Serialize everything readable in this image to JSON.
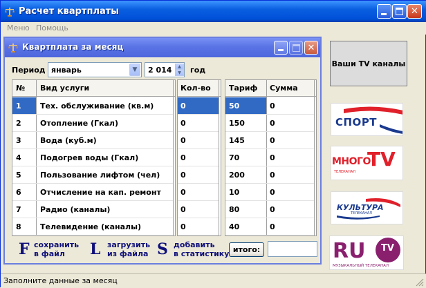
{
  "main_window": {
    "title": "Расчет квартплаты",
    "menu": [
      "Меню",
      "Помощь"
    ]
  },
  "child_window": {
    "title": "Квартплата за месяц",
    "period_label": "Период",
    "month_value": "январь",
    "year_value": "2 014",
    "year_label": "год"
  },
  "grid_services": {
    "headers": [
      "№",
      "Вид услуги"
    ],
    "rows": [
      {
        "num": "1",
        "name": "Тех. обслуживание (кв.м)"
      },
      {
        "num": "2",
        "name": "Отопление (Гкал)"
      },
      {
        "num": "3",
        "name": "Вода (куб.м)"
      },
      {
        "num": "4",
        "name": "Подогрев воды (Гкал)"
      },
      {
        "num": "5",
        "name": "Пользование лифтом (чел)"
      },
      {
        "num": "6",
        "name": "Отчисление на кап. ремонт"
      },
      {
        "num": "7",
        "name": "Радио (каналы)"
      },
      {
        "num": "8",
        "name": "Телевидение (каналы)"
      }
    ]
  },
  "grid_quantity": {
    "header": "Кол-во",
    "values": [
      "0",
      "0",
      "0",
      "0",
      "0",
      "0",
      "0",
      "0"
    ]
  },
  "grid_tariff": {
    "headers": [
      "Тариф",
      "Сумма"
    ],
    "rows": [
      {
        "tariff": "50",
        "sum": "0"
      },
      {
        "tariff": "150",
        "sum": "0"
      },
      {
        "tariff": "145",
        "sum": "0"
      },
      {
        "tariff": "70",
        "sum": "0"
      },
      {
        "tariff": "200",
        "sum": "0"
      },
      {
        "tariff": "10",
        "sum": "0"
      },
      {
        "tariff": "80",
        "sum": "0"
      },
      {
        "tariff": "40",
        "sum": "0"
      }
    ]
  },
  "hotkeys": [
    {
      "letter": "F",
      "line1": "сохранить",
      "line2": "в файл"
    },
    {
      "letter": "L",
      "line1": "загрузить",
      "line2": "из файла"
    },
    {
      "letter": "S",
      "line1": "добавить",
      "line2": "в статистику"
    }
  ],
  "total": {
    "button_label": "итого:",
    "value": ""
  },
  "tv_button_label": "Ваши TV  каналы",
  "channels": [
    {
      "name": "СПОРТ",
      "icon": "sport-logo",
      "color": "#1a3a8f"
    },
    {
      "name": "МНОГО",
      "tv": "TV",
      "sub": "ТЕЛЕКАНАЛ",
      "icon": "mnogo-tv-logo",
      "color": "#e0202a"
    },
    {
      "name": "КУЛЬТУРА",
      "sub": "ТЕЛЕКАНАЛ",
      "icon": "kultura-logo",
      "color": "#1a3a8f"
    },
    {
      "name": "RU",
      "tv": "TV",
      "sub": "МУЗЫКАЛЬНЫЙ ТЕЛЕКАНАЛ",
      "icon": "ru-tv-logo",
      "color": "#8a1f6e"
    }
  ],
  "status_text": "Заполните данные за месяц"
}
